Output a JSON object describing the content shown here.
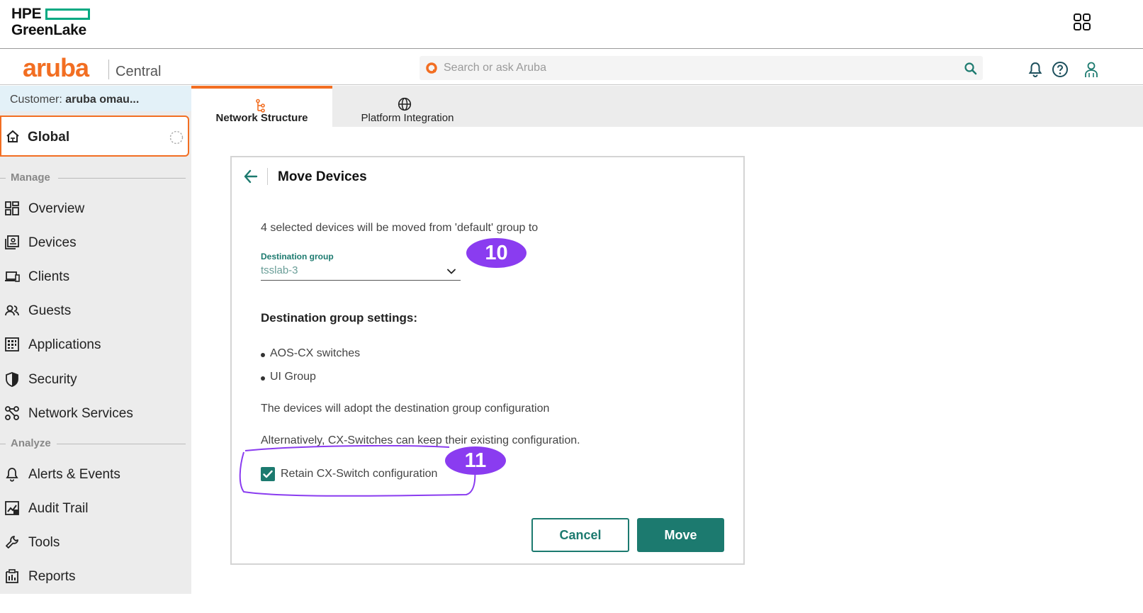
{
  "greenlake": {
    "brand_line1": "HPE",
    "brand_line2": "GreenLake",
    "apps_icon": "grid-apps-icon"
  },
  "header": {
    "aruba_logo": "aruba",
    "product": "Central",
    "search": {
      "placeholder": "Search or ask Aruba",
      "value": ""
    }
  },
  "sidebar": {
    "customer_prefix": "Customer:",
    "customer_name": "aruba omau...",
    "scope": "Global",
    "sections": {
      "manage": "Manage",
      "analyze": "Analyze"
    },
    "manage_items": [
      {
        "label": "Overview",
        "icon": "overview-grid-icon"
      },
      {
        "label": "Devices",
        "icon": "devices-icon"
      },
      {
        "label": "Clients",
        "icon": "clients-laptop-icon"
      },
      {
        "label": "Guests",
        "icon": "guests-icon"
      },
      {
        "label": "Applications",
        "icon": "applications-icon"
      },
      {
        "label": "Security",
        "icon": "security-shield-icon"
      },
      {
        "label": "Network Services",
        "icon": "network-services-icon"
      }
    ],
    "analyze_items": [
      {
        "label": "Alerts & Events",
        "icon": "bell-icon"
      },
      {
        "label": "Audit Trail",
        "icon": "audit-trail-icon"
      },
      {
        "label": "Tools",
        "icon": "wrench-icon"
      },
      {
        "label": "Reports",
        "icon": "reports-icon"
      }
    ]
  },
  "tabs": [
    {
      "label": "Network Structure",
      "active": true
    },
    {
      "label": "Platform Integration",
      "active": false
    }
  ],
  "dialog": {
    "title": "Move Devices",
    "description": "4 selected devices will be moved from 'default' group to",
    "destination_label": "Destination group",
    "destination_value": "tsslab-3",
    "settings_heading": "Destination group settings:",
    "settings": [
      "AOS-CX switches",
      "UI Group"
    ],
    "adopt_text": "The devices will adopt the destination group configuration",
    "alternative_text": "Alternatively, CX-Switches can keep their existing configuration.",
    "retain_label": "Retain CX-Switch configuration",
    "retain_checked": true,
    "cancel_label": "Cancel",
    "move_label": "Move"
  },
  "annotations": {
    "badge_a": "10",
    "badge_b": "11",
    "color": "#8a3cf0"
  },
  "colors": {
    "accent_orange": "#f26e22",
    "accent_teal": "#1c7a6f",
    "hpe_green": "#01a982"
  }
}
